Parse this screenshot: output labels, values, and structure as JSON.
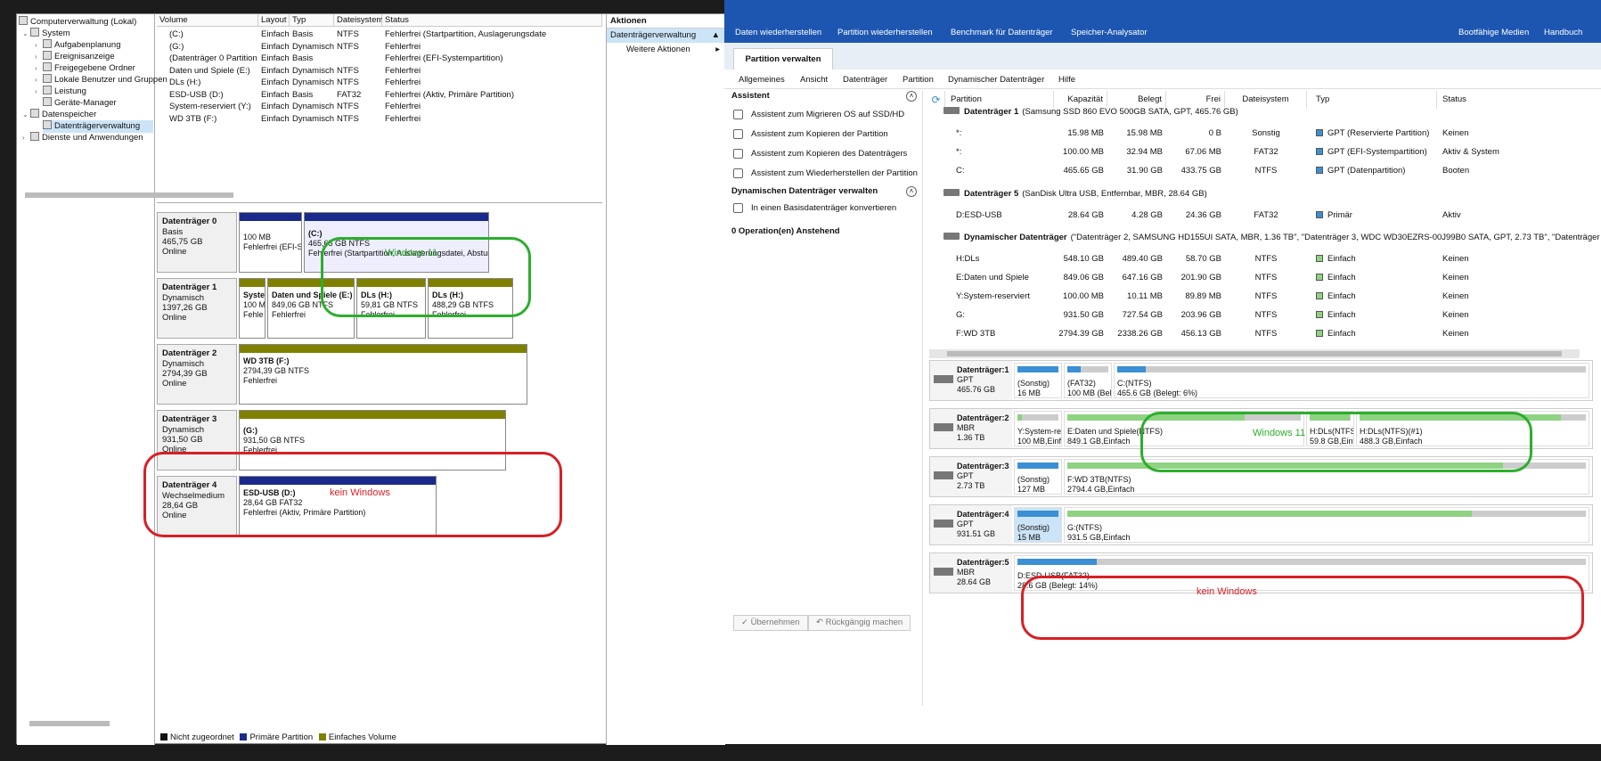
{
  "tree": {
    "root": "Computerverwaltung (Lokal)",
    "system": "System",
    "aufgaben": "Aufgabenplanung",
    "ereignis": "Ereignisanzeige",
    "freigaben": "Freigegebene Ordner",
    "benutzer": "Lokale Benutzer und Gruppen",
    "leistung": "Leistung",
    "geraete": "Geräte-Manager",
    "speicher": "Datenspeicher",
    "dtv": "Datenträgerverwaltung",
    "dienste": "Dienste und Anwendungen"
  },
  "volumes": {
    "headers": [
      "Volume",
      "Layout",
      "Typ",
      "Dateisystem",
      "Status"
    ],
    "rows": [
      [
        "(C:)",
        "Einfach",
        "Basis",
        "NTFS",
        "Fehlerfrei (Startpartition, Auslagerungsdate"
      ],
      [
        "(G:)",
        "Einfach",
        "Dynamisch",
        "NTFS",
        "Fehlerfrei"
      ],
      [
        "(Datenträger 0 Partition 2)",
        "Einfach",
        "Basis",
        "",
        "Fehlerfrei (EFI-Systempartition)"
      ],
      [
        "Daten und Spiele (E:)",
        "Einfach",
        "Dynamisch",
        "NTFS",
        "Fehlerfrei"
      ],
      [
        "DLs (H:)",
        "Einfach",
        "Dynamisch",
        "NTFS",
        "Fehlerfrei"
      ],
      [
        "ESD-USB (D:)",
        "Einfach",
        "Basis",
        "FAT32",
        "Fehlerfrei (Aktiv, Primäre Partition)"
      ],
      [
        "System-reserviert (Y:)",
        "Einfach",
        "Dynamisch",
        "NTFS",
        "Fehlerfrei"
      ],
      [
        "WD 3TB (F:)",
        "Einfach",
        "Dynamisch",
        "NTFS",
        "Fehlerfrei"
      ]
    ]
  },
  "disks": {
    "d0": {
      "name": "Datenträger 0",
      "type": "Basis",
      "size": "465,75 GB",
      "state": "Online",
      "p1a": "100 MB",
      "p1b": "Fehlerfrei (EFI-Sy",
      "p2a": "(C:)",
      "p2b": "465,65 GB NTFS",
      "p2c": "Fehlerfrei (Startpartition, Auslagerungsdatei, Absturzal"
    },
    "d1": {
      "name": "Datenträger 1",
      "type": "Dynamisch",
      "size": "1397,26 GB",
      "state": "Online",
      "p1a": "Syste",
      "p1b": "100 M",
      "p1c": "Fehle",
      "p2a": "Daten und Spiele  (E:)",
      "p2b": "849,06 GB NTFS",
      "p2c": "Fehlerfrei",
      "p3a": "DLs  (H:)",
      "p3b": "59,81 GB NTFS",
      "p3c": "Fehlerfrei",
      "p4a": "DLs  (H:)",
      "p4b": "488,29 GB NTFS",
      "p4c": "Fehlerfrei"
    },
    "d2": {
      "name": "Datenträger 2",
      "type": "Dynamisch",
      "size": "2794,39 GB",
      "state": "Online",
      "p1a": "WD 3TB  (F:)",
      "p1b": "2794,39 GB NTFS",
      "p1c": "Fehlerfrei"
    },
    "d3": {
      "name": "Datenträger 3",
      "type": "Dynamisch",
      "size": "931,50 GB",
      "state": "Online",
      "p1a": "(G:)",
      "p1b": "931,50 GB NTFS",
      "p1c": "Fehlerfrei"
    },
    "d4": {
      "name": "Datenträger 4",
      "type": "Wechselmedium",
      "size": "28,64 GB",
      "state": "Online",
      "p1a": "ESD-USB  (D:)",
      "p1b": "28,64 GB FAT32",
      "p1c": "Fehlerfrei (Aktiv, Primäre Partition)"
    }
  },
  "legend": {
    "a": "Nicht zugeordnet",
    "b": "Primäre Partition",
    "c": "Einfaches Volume"
  },
  "actions": {
    "title": "Aktionen",
    "sel": "Datenträgerverwaltung",
    "more": "Weitere Aktionen"
  },
  "annot": {
    "win": "Windows 11",
    "kein": "kein Windows"
  },
  "mt": {
    "toolbar": [
      "Daten wiederherstellen",
      "Partition wiederherstellen",
      "Benchmark für Datenträger",
      "Speicher-Analysator",
      "Bootfähige Medien",
      "Handbuch"
    ],
    "tab": "Partition verwalten",
    "menu": [
      "Allgemeines",
      "Ansicht",
      "Datenträger",
      "Partition",
      "Dynamischer Datenträger",
      "Hilfe"
    ],
    "wizH": "Assistent",
    "wiz": [
      "Assistent zum Migrieren OS auf SSD/HD",
      "Assistent zum Kopieren der Partition",
      "Assistent zum Kopieren des Datenträgers",
      "Assistent zum Wiederherstellen der Partition"
    ],
    "dynH": "Dynamischen Datenträger verwalten",
    "dyn": "In einen Basisdatenträger konvertieren",
    "ops": "0 Operation(en) Anstehend",
    "cols": [
      "Partition",
      "Kapazität",
      "Belegt",
      "Frei",
      "Dateisystem",
      "Typ",
      "Status"
    ],
    "d1h": "Datenträger 1",
    "d1d": "(Samsung SSD 860 EVO 500GB SATA, GPT, 465.76 GB)",
    "d1r": [
      [
        "*:",
        "15.98 MB",
        "15.98 MB",
        "0 B",
        "Sonstig",
        "GPT (Reservierte Partition)",
        "Keinen"
      ],
      [
        "*:",
        "100.00 MB",
        "32.94 MB",
        "67.06 MB",
        "FAT32",
        "GPT (EFI-Systempartition)",
        "Aktiv & System"
      ],
      [
        "C:",
        "465.65 GB",
        "31.90 GB",
        "433.75 GB",
        "NTFS",
        "GPT (Datenpartition)",
        "Booten"
      ]
    ],
    "d5h": "Datenträger 5",
    "d5d": "(SanDisk Ultra USB, Entfernbar, MBR, 28.64 GB)",
    "d5r": [
      [
        "D:ESD-USB",
        "28.64 GB",
        "4.28 GB",
        "24.36 GB",
        "FAT32",
        "Primär",
        "Aktiv"
      ]
    ],
    "dyh": "Dynamischer Datenträger",
    "dyd": "(\"Datenträger 2, SAMSUNG HD155UI SATA, MBR, 1.36 TB\", \"Datenträger 3, WDC WD30EZRS-00J99B0 SATA, GPT, 2.73 TB\", \"Datenträger",
    "dyr": [
      [
        "H:DLs",
        "548.10 GB",
        "489.40 GB",
        "58.70 GB",
        "NTFS",
        "Einfach",
        "Keinen"
      ],
      [
        "E:Daten und Spiele",
        "849.06 GB",
        "647.16 GB",
        "201.90 GB",
        "NTFS",
        "Einfach",
        "Keinen"
      ],
      [
        "Y:System-reserviert",
        "100.00 MB",
        "10.11 MB",
        "89.89 MB",
        "NTFS",
        "Einfach",
        "Keinen"
      ],
      [
        "G:",
        "931.50 GB",
        "727.54 GB",
        "203.96 GB",
        "NTFS",
        "Einfach",
        "Keinen"
      ],
      [
        "F:WD 3TB",
        "2794.39 GB",
        "2338.26 GB",
        "456.13 GB",
        "NTFS",
        "Einfach",
        "Keinen"
      ]
    ],
    "map": {
      "m1": {
        "n": "Datenträger:1",
        "t": "GPT",
        "s": "465.76 GB",
        "a1": "(Sonstig)",
        "a2": "16 MB",
        "b1": "(FAT32)",
        "b2": "100 MB (Bele",
        "c1": "C:(NTFS)",
        "c2": "465.6 GB (Belegt: 6%)"
      },
      "m2": {
        "n": "Datenträger:2",
        "t": "MBR",
        "s": "1.36 TB",
        "a1": "Y:System-res",
        "a2": "100 MB,Einfa",
        "b1": "E:Daten und Spiele(NTFS)",
        "b2": "849.1 GB,Einfach",
        "c1": "H:DLs(NTFS)(",
        "c2": "59.8 GB,Einfa",
        "d1": "H:DLs(NTFS)(#1)",
        "d2": "488.3 GB,Einfach"
      },
      "m3": {
        "n": "Datenträger:3",
        "t": "GPT",
        "s": "2.73 TB",
        "a1": "(Sonstig)",
        "a2": "127 MB",
        "b1": "F:WD 3TB(NTFS)",
        "b2": "2794.4 GB,Einfach"
      },
      "m4": {
        "n": "Datenträger:4",
        "t": "GPT",
        "s": "931.51 GB",
        "a1": "(Sonstig)",
        "a2": "15 MB",
        "b1": "G:(NTFS)",
        "b2": "931.5 GB,Einfach"
      },
      "m5": {
        "n": "Datenträger:5",
        "t": "MBR",
        "s": "28.64 GB",
        "a1": "D:ESD-USB(FAT32)",
        "a2": "28.6 GB (Belegt: 14%)"
      }
    },
    "apply": "Übernehmen",
    "undo": "Rückgängig machen"
  },
  "colors": {
    "primary": "#1a2a8c",
    "simple": "#808000",
    "blue": "#3b8fd4",
    "green": "#8fd282",
    "annotGreen": "#2cae2c",
    "annotRed": "#d81f26"
  }
}
